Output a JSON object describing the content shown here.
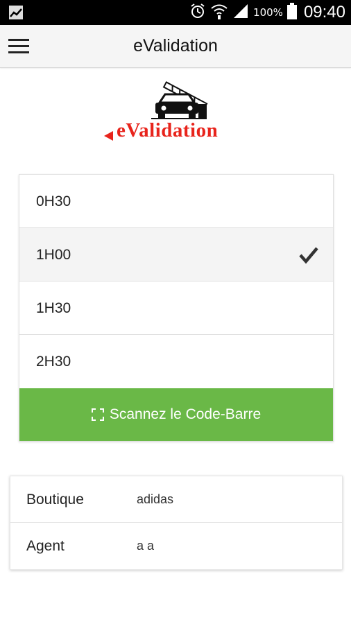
{
  "status_bar": {
    "battery": "100%",
    "time": "09:40",
    "icons": [
      "gallery-icon",
      "alarm-icon",
      "wifi-icon",
      "signal-icon",
      "battery-icon"
    ]
  },
  "toolbar": {
    "title": "eValidation",
    "menu_icon": "hamburger-menu-icon"
  },
  "logo": {
    "text": "eValidation",
    "color": "#e8241c"
  },
  "options": [
    {
      "label": "0H30",
      "selected": false
    },
    {
      "label": "1H00",
      "selected": true
    },
    {
      "label": "1H30",
      "selected": false
    },
    {
      "label": "2H30",
      "selected": false
    }
  ],
  "scan_button": {
    "label": "Scannez le Code-Barre",
    "icon": "scan-frame-icon",
    "color": "#6ab847"
  },
  "info": {
    "rows": [
      {
        "label": "Boutique",
        "value": "adidas"
      },
      {
        "label": "Agent",
        "value": "a a"
      }
    ]
  }
}
